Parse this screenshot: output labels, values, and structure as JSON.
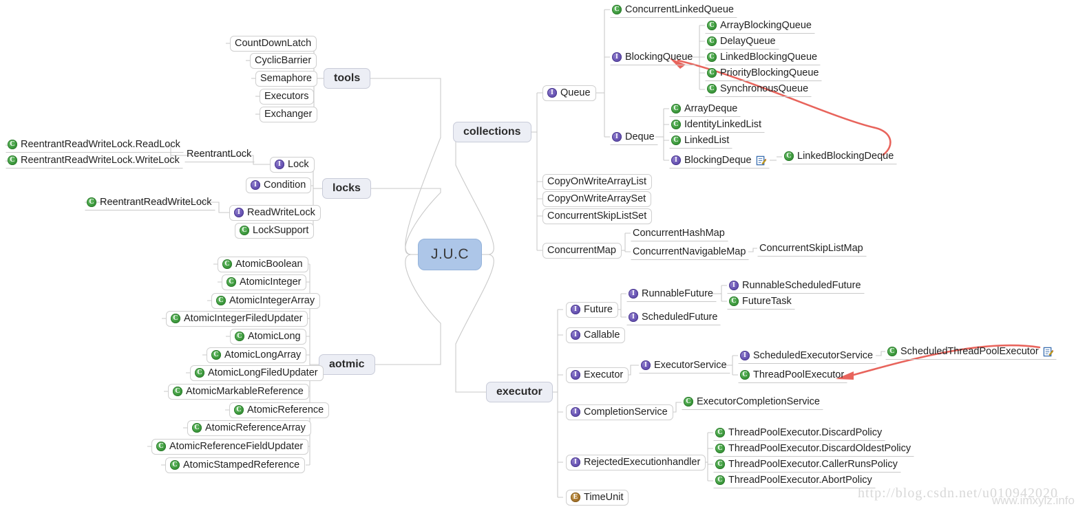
{
  "root": {
    "label": "J.U.C"
  },
  "branches": [
    {
      "key": "tools",
      "label": "tools"
    },
    {
      "key": "locks",
      "label": "locks"
    },
    {
      "key": "aotmic",
      "label": "aotmic"
    },
    {
      "key": "collections",
      "label": "collections"
    },
    {
      "key": "executor",
      "label": "executor"
    }
  ],
  "nodes": {
    "tools": [
      {
        "label": "CountDownLatch",
        "icon": "none"
      },
      {
        "label": "CyclicBarrier",
        "icon": "none"
      },
      {
        "label": "Semaphore",
        "icon": "none"
      },
      {
        "label": "Executors",
        "icon": "none"
      },
      {
        "label": "Exchanger",
        "icon": "none"
      }
    ],
    "locks": [
      {
        "label": "Lock",
        "icon": "I"
      },
      {
        "label": "Condition",
        "icon": "I"
      },
      {
        "label": "ReadWriteLock",
        "icon": "I"
      },
      {
        "label": "LockSupport",
        "icon": "C"
      },
      {
        "label": "ReentrantLock",
        "icon": "none"
      },
      {
        "label": "ReentrantReadWriteLock.ReadLock",
        "icon": "C"
      },
      {
        "label": "ReentrantReadWriteLock.WriteLock",
        "icon": "C"
      },
      {
        "label": "ReentrantReadWriteLock",
        "icon": "C"
      }
    ],
    "aotmic": [
      {
        "label": "AtomicBoolean",
        "icon": "C"
      },
      {
        "label": "AtomicInteger",
        "icon": "C"
      },
      {
        "label": "AtomicIntegerArray",
        "icon": "C"
      },
      {
        "label": "AtomicIntegerFiledUpdater",
        "icon": "C"
      },
      {
        "label": "AtomicLong",
        "icon": "C"
      },
      {
        "label": "AtomicLongArray",
        "icon": "C"
      },
      {
        "label": "AtomicLongFiledUpdater",
        "icon": "C"
      },
      {
        "label": "AtomicMarkableReference",
        "icon": "C"
      },
      {
        "label": "AtomicReference",
        "icon": "C"
      },
      {
        "label": "AtomicReferenceArray",
        "icon": "C"
      },
      {
        "label": "AtomicReferenceFieldUpdater",
        "icon": "C"
      },
      {
        "label": "AtomicStampedReference",
        "icon": "C"
      }
    ],
    "collections": [
      {
        "label": "Queue",
        "icon": "I"
      },
      {
        "label": "ConcurrentLinkedQueue",
        "icon": "C"
      },
      {
        "label": "BlockingQueue",
        "icon": "I"
      },
      {
        "label": "ArrayBlockingQueue",
        "icon": "C"
      },
      {
        "label": "DelayQueue",
        "icon": "C"
      },
      {
        "label": "LinkedBlockingQueue",
        "icon": "C"
      },
      {
        "label": "PriorityBlockingQueue",
        "icon": "C"
      },
      {
        "label": "SynchronousQueue",
        "icon": "C"
      },
      {
        "label": "Deque",
        "icon": "I"
      },
      {
        "label": "ArrayDeque",
        "icon": "C"
      },
      {
        "label": "IdentityLinkedList",
        "icon": "C"
      },
      {
        "label": "LinkedList",
        "icon": "C"
      },
      {
        "label": "BlockingDeque",
        "icon": "I",
        "memo": true
      },
      {
        "label": "LinkedBlockingDeque",
        "icon": "C"
      },
      {
        "label": "CopyOnWriteArrayList",
        "icon": "none"
      },
      {
        "label": "CopyOnWriteArraySet",
        "icon": "none"
      },
      {
        "label": "ConcurrentSkipListSet",
        "icon": "none"
      },
      {
        "label": "ConcurrentMap",
        "icon": "none"
      },
      {
        "label": "ConcurrentHashMap",
        "icon": "none"
      },
      {
        "label": "ConcurrentNavigableMap",
        "icon": "none"
      },
      {
        "label": "ConcurrentSkipListMap",
        "icon": "none"
      }
    ],
    "executor": [
      {
        "label": "Future",
        "icon": "I"
      },
      {
        "label": "RunnableFuture",
        "icon": "I"
      },
      {
        "label": "RunnableScheduledFuture",
        "icon": "I"
      },
      {
        "label": "FutureTask",
        "icon": "C"
      },
      {
        "label": "ScheduledFuture",
        "icon": "I"
      },
      {
        "label": "Callable",
        "icon": "I"
      },
      {
        "label": "Executor",
        "icon": "I"
      },
      {
        "label": "ExecutorService",
        "icon": "I"
      },
      {
        "label": "ScheduledExecutorService",
        "icon": "I"
      },
      {
        "label": "ThreadPoolExecutor",
        "icon": "C"
      },
      {
        "label": "ScheduledThreadPoolExecutor",
        "icon": "C",
        "memo": true
      },
      {
        "label": "CompletionService",
        "icon": "I"
      },
      {
        "label": "ExecutorCompletionService",
        "icon": "C"
      },
      {
        "label": "RejectedExecutionhandler",
        "icon": "I"
      },
      {
        "label": "ThreadPoolExecutor.DiscardPolicy",
        "icon": "C"
      },
      {
        "label": "ThreadPoolExecutor.DiscardOldestPolicy",
        "icon": "C"
      },
      {
        "label": "ThreadPoolExecutor.CallerRunsPolicy",
        "icon": "C"
      },
      {
        "label": "ThreadPoolExecutor.AbortPolicy",
        "icon": "C"
      },
      {
        "label": "TimeUnit",
        "icon": "E"
      }
    ]
  },
  "watermarks": {
    "csdn": "http://blog.csdn.net/u010942020",
    "imxylz": "www.imxylz.info"
  },
  "colors": {
    "root_fill": "#adc6e8",
    "branch_fill": "#eceef5",
    "class_icon": "#3f9c3f",
    "interface_icon": "#6a56b5",
    "enum_icon": "#a8762c",
    "arrow": "#e8645c",
    "link": "#c9c9c9"
  },
  "annotations": {
    "arrow_to_blocking_queue": "red arrow pointing to BlockingQueue",
    "arrow_to_thread_pool_executor": "red arrow pointing to ThreadPoolExecutor"
  }
}
